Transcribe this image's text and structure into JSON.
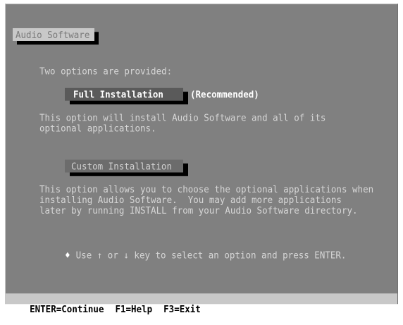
{
  "screen": {
    "title": "Audio Software",
    "intro": "Two options are provided:",
    "options": [
      {
        "label": "Full Installation",
        "note": "(Recommended)",
        "description": [
          "This option will install Audio Software and all of its",
          "optional applications."
        ],
        "selected": true
      },
      {
        "label": "Custom Installation",
        "description": [
          "This option allows you to choose the optional applications when",
          "installing Audio Software.  You may add more applications",
          "later by running INSTALL from your Audio Software directory."
        ],
        "selected": false
      }
    ],
    "hint_bullet": "♦",
    "hint": "Use ↑ or ↓ key to select an option and press ENTER."
  },
  "statusbar": {
    "items": [
      "ENTER=Continue",
      "F1=Help",
      "F3=Exit"
    ]
  },
  "colors": {
    "background": "#808080",
    "text": "#d6d6d6",
    "highlight_bar": "#c8c8c8",
    "shadow": "#000000"
  }
}
